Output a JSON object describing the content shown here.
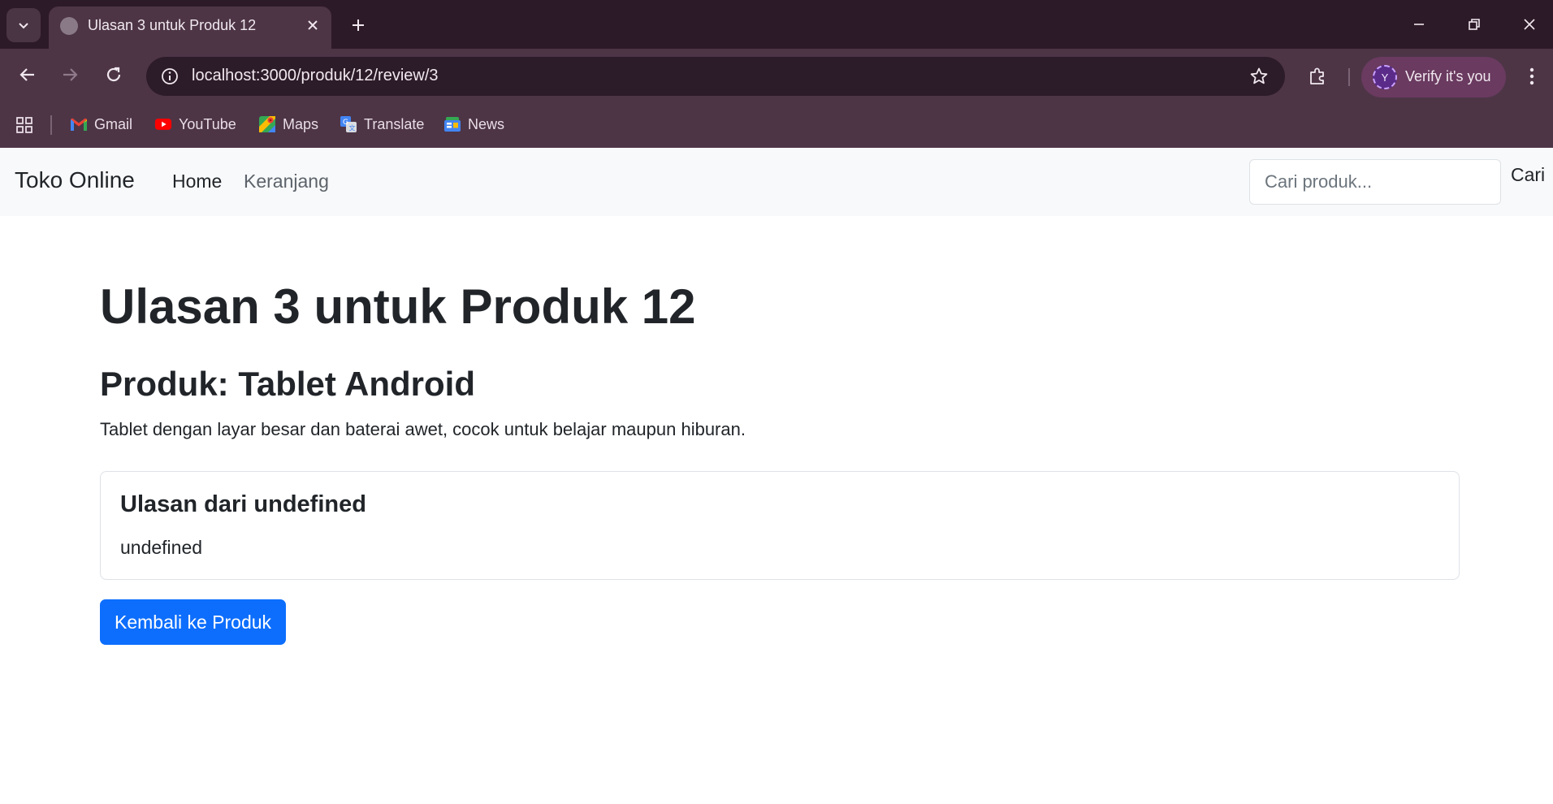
{
  "browser": {
    "tab": {
      "title": "Ulasan 3 untuk Produk 12"
    },
    "url": "localhost:3000/produk/12/review/3",
    "profile": {
      "initial": "Y",
      "label": "Verify it's you"
    },
    "bookmarks": [
      {
        "label": "Gmail",
        "icon": "gmail-icon"
      },
      {
        "label": "YouTube",
        "icon": "youtube-icon"
      },
      {
        "label": "Maps",
        "icon": "maps-icon"
      },
      {
        "label": "Translate",
        "icon": "translate-icon"
      },
      {
        "label": "News",
        "icon": "news-icon"
      }
    ]
  },
  "navbar": {
    "brand": "Toko Online",
    "links": [
      {
        "label": "Home",
        "active": true
      },
      {
        "label": "Keranjang",
        "active": false
      }
    ],
    "search": {
      "placeholder": "Cari produk...",
      "value": "",
      "button_label": "Cari"
    }
  },
  "main": {
    "title": "Ulasan 3 untuk Produk 12",
    "product_heading": "Produk: Tablet Android",
    "product_description": "Tablet dengan layar besar dan baterai awet, cocok untuk belajar maupun hiburan.",
    "review": {
      "title": "Ulasan dari undefined",
      "body": "undefined"
    },
    "back_button_label": "Kembali ke Produk"
  },
  "colors": {
    "primary": "#0d6efd",
    "navbar_bg": "#f8f9fa",
    "text": "#212529",
    "muted_link": "#5c636a",
    "chrome_frame": "#2d1a28",
    "chrome_toolbar": "#4d3546"
  }
}
